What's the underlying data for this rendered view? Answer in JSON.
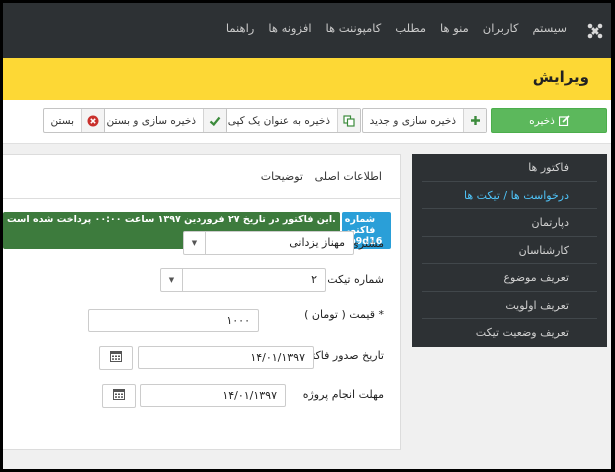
{
  "nav": {
    "items": [
      "سیستم",
      "کاربران",
      "منو ها",
      "مطلب",
      "کامپوننت ها",
      "افزونه ها",
      "راهنما"
    ]
  },
  "page": {
    "title": "ویرایش"
  },
  "toolbar": {
    "save": "ذخیره",
    "save_new": "ذخیره سازی و جدید",
    "save_copy": "ذخیره به عنوان یک کپی",
    "save_close": "ذخیره سازی و بستن",
    "close": "بستن"
  },
  "sidebar": {
    "items": [
      "فاکتور ها",
      "درخواست ها / تیکت ها",
      "دپارتمان",
      "کارشناسان",
      "تعریف موضوع",
      "تعریف اولویت",
      "تعریف وضعیت تیکت"
    ],
    "active_index": 1
  },
  "tabs": [
    "اطلاعات اصلی",
    "توضیحات"
  ],
  "alerts": {
    "invoice_number": "شماره فاکتور fb9d16",
    "paid_notice": "این فاکتور در تاریخ ۲۷ فروردین ۱۳۹۷ ساعت ۰۰:۰۰ پرداخت شده است."
  },
  "form": {
    "customer_label": "مشتری",
    "customer_value": "مهناز یزدانی",
    "ticket_label": "شماره تیکت",
    "ticket_value": "۲",
    "price_label": "قیمت ( تومان ) *",
    "price_value": "۱۰۰۰",
    "issue_date_label": "تاریخ صدور فاکتور",
    "issue_date_value": "۱۴/۰۱/۱۳۹۷",
    "deadline_label": "مهلت انجام پروژه",
    "deadline_value": "۱۴/۰۱/۱۳۹۷"
  },
  "colors": {
    "topbar": "#2d3134",
    "title_band": "#fdd835",
    "save": "#5cb85c",
    "active_menu": "#4fc3f7",
    "info_blue": "#2a9fd8",
    "success_green": "#3d7b3d"
  }
}
